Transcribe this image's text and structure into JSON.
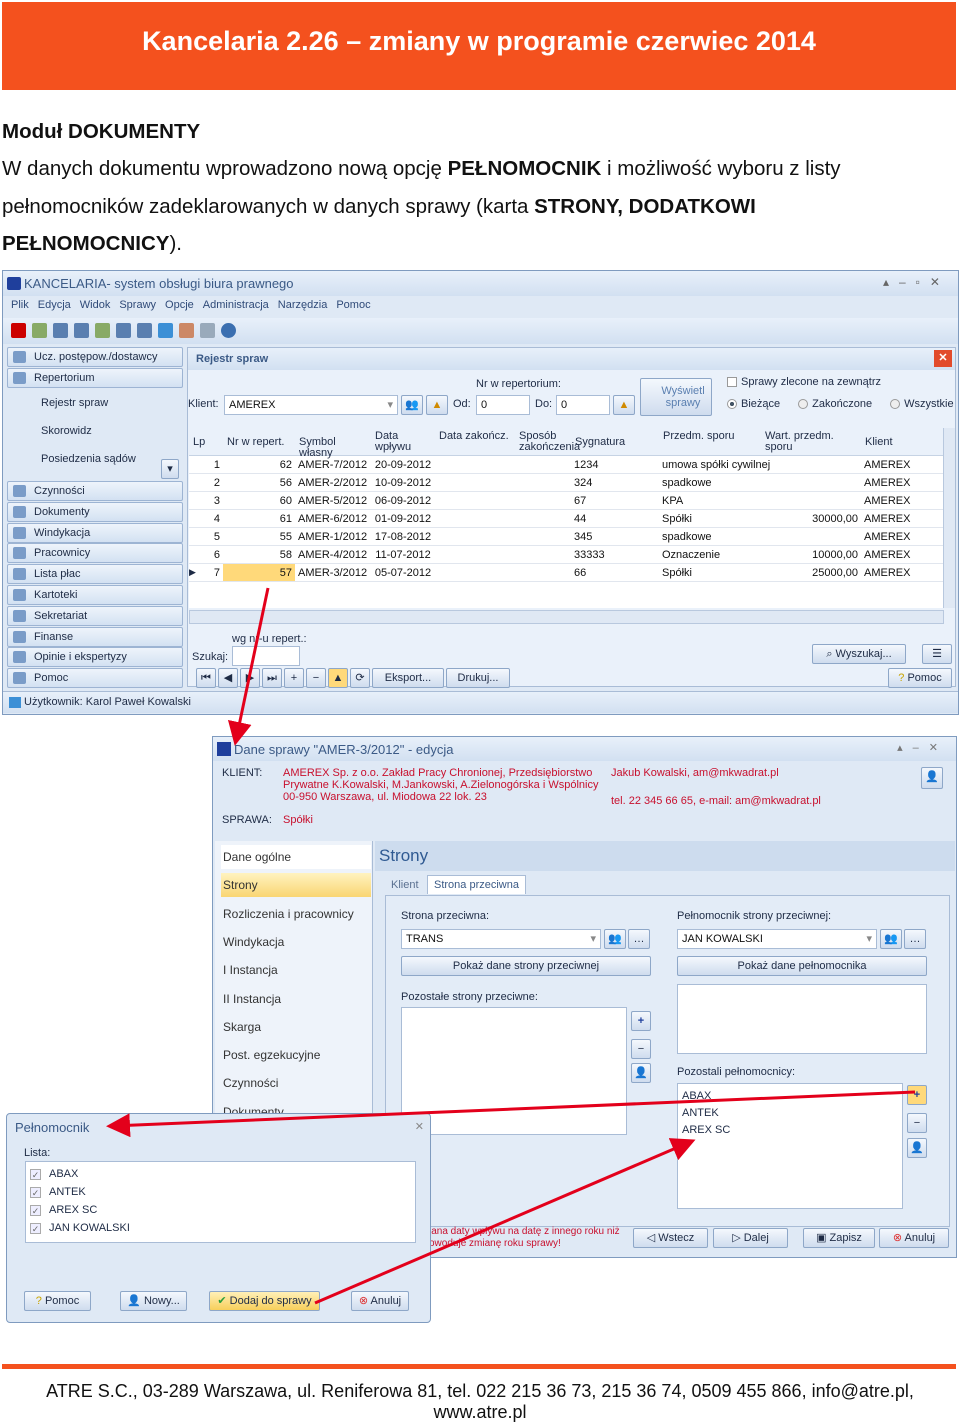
{
  "header": {
    "title": "Kancelaria 2.26 – zmiany w programie czerwiec 2014"
  },
  "doc": {
    "section": "Moduł DOKUMENTY",
    "p1a": "W danych dokumentu wprowadzono nową opcję ",
    "p1b": "PEŁNOMOCNIK",
    "p1c": " i możliwość wyboru z listy",
    "p2a": "pełnomocników zadeklarowanych w danych sprawy (karta ",
    "p2b": "STRONY, DODATKOWI",
    "p3a": "PEŁNOMOCNICY",
    "p3b": ")."
  },
  "app": {
    "title": "KANCELARIA- system obsługi biura prawnego",
    "menu": [
      "Plik",
      "Edycja",
      "Widok",
      "Sprawy",
      "Opcje",
      "Administracja",
      "Narzędzia",
      "Pomoc"
    ],
    "nav": {
      "top": [
        "Ucz. postępow./dostawcy",
        "Repertorium"
      ],
      "sub": [
        "Rejestr spraw",
        "Skorowidz",
        "Posiedzenia sądów"
      ],
      "bottom": [
        "Czynności",
        "Dokumenty",
        "Windykacja",
        "Pracownicy",
        "Lista płac",
        "Kartoteki",
        "Sekretariat",
        "Finanse",
        "Opinie i ekspertyzy",
        "Pomoc"
      ]
    },
    "panel_title": "Rejestr spraw",
    "filter": {
      "klient_label": "Klient:",
      "klient_value": "AMEREX",
      "nr_label": "Nr w repertorium:",
      "od_label": "Od:",
      "od_value": "0",
      "do_label": "Do:",
      "do_value": "0",
      "show_button": "Wyświetl sprawy",
      "outsourced": "Sprawy zlecone na zewnątrz",
      "radios": [
        "Bieżące",
        "Zakończone",
        "Wszystkie"
      ],
      "selected_radio": "Bieżące"
    },
    "grid": {
      "columns": [
        "Lp",
        "Nr w repert.",
        "Symbol własny",
        "Data wpływu",
        "Data zakończ.",
        "Sposób zakończenia",
        "Sygnatura",
        "Przedm. sporu",
        "Wart. przedm. sporu",
        "Klient"
      ],
      "rows": [
        [
          "1",
          "62",
          "AMER-7/2012",
          "20-09-2012",
          "",
          "",
          "1234",
          "umowa spółki cywilnej",
          "",
          "AMEREX"
        ],
        [
          "2",
          "56",
          "AMER-2/2012",
          "10-09-2012",
          "",
          "",
          "324",
          "spadkowe",
          "",
          "AMEREX"
        ],
        [
          "3",
          "60",
          "AMER-5/2012",
          "06-09-2012",
          "",
          "",
          "67",
          "KPA",
          "",
          "AMEREX"
        ],
        [
          "4",
          "61",
          "AMER-6/2012",
          "01-09-2012",
          "",
          "",
          "44",
          "Spółki",
          "30000,00",
          "AMEREX"
        ],
        [
          "5",
          "55",
          "AMER-1/2012",
          "17-08-2012",
          "",
          "",
          "345",
          "spadkowe",
          "",
          "AMEREX"
        ],
        [
          "6",
          "58",
          "AMER-4/2012",
          "11-07-2012",
          "",
          "",
          "33333",
          "Oznaczenie",
          "10000,00",
          "AMEREX"
        ],
        [
          "7",
          "57",
          "AMER-3/2012",
          "05-07-2012",
          "",
          "",
          "66",
          "Spółki",
          "25000,00",
          "AMEREX"
        ]
      ],
      "selected_row": "7"
    },
    "search": {
      "hint": "wg nr-u repert.:",
      "label": "Szukaj:",
      "value": "",
      "find_button": "Wyszukaj..."
    },
    "toolbar": {
      "export": "Eksport...",
      "print": "Drukuj...",
      "help": "Pomoc"
    },
    "status": "Użytkownik: Karol Paweł Kowalski"
  },
  "edit": {
    "title": "Dane sprawy \"AMER-3/2012\" - edycja",
    "klient_label": "KLIENT:",
    "klient_lines": [
      "AMEREX Sp. z o.o. Zakład Pracy Chronionej, Przedsiębiorstwo",
      "Prywatne K.Kowalski, M.Jankowski, A.Zielonogórska i Wspólnicy",
      "00-950 Warszawa, ul. Miodowa 22 lok. 23"
    ],
    "contact": "Jakub Kowalski, am@mkwadrat.pl",
    "phone": "tel. 22 345 66 65, e-mail: am@mkwadrat.pl",
    "sprawa_label": "SPRAWA:",
    "sprawa_value": "Spółki",
    "side": [
      "Dane ogólne",
      "Strony",
      "Rozliczenia i pracownicy",
      "Windykacja",
      "I Instancja",
      "II Instancja",
      "Skarga",
      "Post. egzekucyjne",
      "Czynności",
      "Dokumenty"
    ],
    "side_active": "Strony",
    "section_title": "Strony",
    "tabs": [
      "Klient",
      "Strona przeciwna"
    ],
    "active_tab": "Strona przeciwna",
    "opp_label": "Strona przeciwna:",
    "opp_value": "TRANS",
    "opp_show": "Pokaż dane strony przeciwnej",
    "other_opp_label": "Pozostałe strony przeciwne:",
    "att_label": "Pełnomocnik strony przeciwnej:",
    "att_value": "JAN KOWALSKI",
    "att_show": "Pokaż dane pełnomocnika",
    "other_att_label": "Pozostali pełnomocnicy:",
    "other_att": [
      "ABAX",
      "ANTEK",
      "AREX SC"
    ],
    "warning": [
      "iana daty wpływu na datę z innego roku niż",
      "owoduje zmianę roku sprawy!"
    ],
    "buttons": {
      "back": "Wstecz",
      "next": "Dalej",
      "save": "Zapisz",
      "cancel": "Anuluj"
    }
  },
  "dialog": {
    "title": "Pełnomocnik",
    "list_label": "Lista:",
    "items": [
      "ABAX",
      "ANTEK",
      "AREX SC",
      "JAN KOWALSKI"
    ],
    "checked": [
      true,
      true,
      true,
      true
    ],
    "buttons": {
      "help": "Pomoc",
      "new": "Nowy...",
      "add": "Dodaj do sprawy",
      "cancel": "Anuluj"
    }
  },
  "footer": "ATRE S.C., 03-289 Warszawa, ul. Reniferowa 81, tel. 022 215 36 73, 215 36 74, 0509 455 866, info@atre.pl, www.atre.pl",
  "colors": {
    "brand": "#f4511e",
    "arrow": "#e3001b",
    "highlight": "#ffd97a"
  }
}
